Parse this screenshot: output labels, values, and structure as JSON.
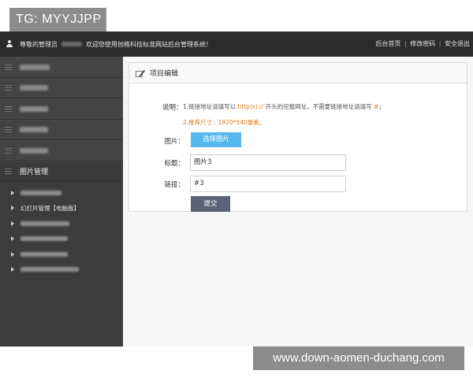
{
  "watermark_tag": "TG: MYYJJPP",
  "site_watermark": "www.down-aomen-duchang.com",
  "topbar": {
    "greeting": "尊敬的管理员",
    "welcome": "欢迎您使用创格科技标准网站后台管理系统！",
    "links": [
      "后台首页",
      "修改密码",
      "安全退出"
    ],
    "separator": "|"
  },
  "sidebar": {
    "menu_items": [
      {
        "label": "",
        "blurred": true
      },
      {
        "label": "",
        "blurred": true
      },
      {
        "label": "",
        "blurred": true
      },
      {
        "label": "",
        "blurred": true
      },
      {
        "label": "",
        "blurred": true
      },
      {
        "label": "图片管理",
        "blurred": false,
        "active": true
      }
    ],
    "sub_items": [
      {
        "label": "",
        "blurred": true
      },
      {
        "label": "幻灯片管理【电脑版】",
        "blurred": false
      },
      {
        "label": "",
        "blurred": true
      },
      {
        "label": "",
        "blurred": true
      },
      {
        "label": "",
        "blurred": true
      },
      {
        "label": "",
        "blurred": true
      }
    ]
  },
  "panel": {
    "title": "项目编辑",
    "note_label": "说明：",
    "note1_prefix": "1.链接地址请填写以 ",
    "note1_highlight": "http(s)://",
    "note1_middle": " 开头的完整网址，不需要链接地址请填写 ",
    "note1_hash": "#",
    "note1_suffix": "；",
    "note2": "2.推荐尺寸：1920*540像素。",
    "image_label": "图片：",
    "choose_button": "选择图片",
    "title_label": "标题：",
    "title_value": "图片3",
    "link_label": "链接：",
    "link_value": "#3",
    "submit_button": "提交"
  },
  "colors": {
    "topbar_bg": "#2b2b2b",
    "sidebar_bg": "#3c3c3c",
    "accent_blue": "#55b8ee",
    "submit_bg": "#5a6275",
    "note_orange": "#e07a1f"
  }
}
